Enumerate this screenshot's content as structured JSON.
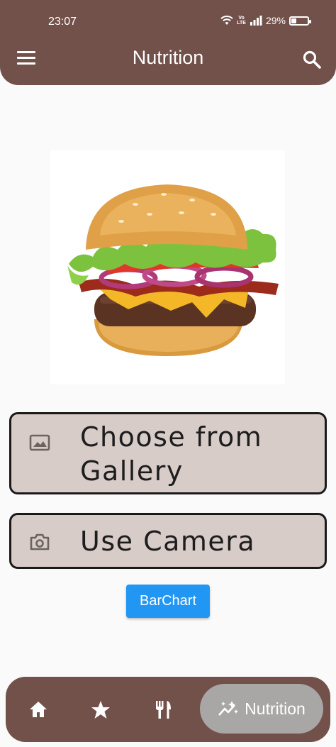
{
  "status_bar": {
    "time": "23:07",
    "network": "VoLTE",
    "battery": "29%",
    "battery_level": 0.29
  },
  "app_bar": {
    "title": "Nutrition",
    "menu_icon": "menu-icon",
    "search_icon": "search-icon"
  },
  "food_image": {
    "subject": "burger-image"
  },
  "buttons": {
    "gallery": {
      "label": "Choose from Gallery",
      "icon": "image-icon"
    },
    "camera": {
      "label": "Use Camera",
      "icon": "camera-icon"
    },
    "barchart": {
      "label": "BarChart"
    }
  },
  "bottom_nav": {
    "items": [
      {
        "icon": "home-icon"
      },
      {
        "icon": "star-icon"
      },
      {
        "icon": "restaurant-icon"
      },
      {
        "icon": "auto-graph-icon",
        "label": "Nutrition",
        "selected": true
      }
    ]
  },
  "colors": {
    "primary": "#72514a",
    "button_bg": "#d8ccc8",
    "barchart_blue": "#2196f3",
    "nav_selected": "#a8a7a6"
  }
}
